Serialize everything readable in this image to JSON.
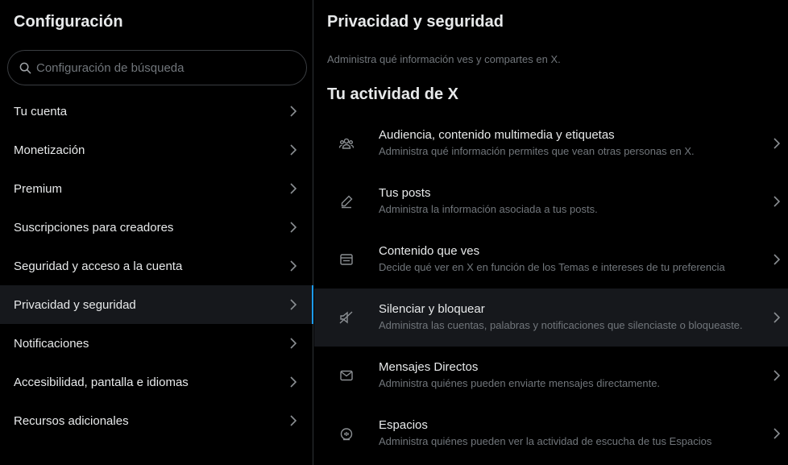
{
  "left": {
    "title": "Configuración",
    "search_placeholder": "Configuración de búsqueda",
    "items": [
      {
        "label": "Tu cuenta"
      },
      {
        "label": "Monetización"
      },
      {
        "label": "Premium"
      },
      {
        "label": "Suscripciones para creadores"
      },
      {
        "label": "Seguridad y acceso a la cuenta"
      },
      {
        "label": "Privacidad y seguridad",
        "active": true
      },
      {
        "label": "Notificaciones"
      },
      {
        "label": "Accesibilidad, pantalla e idiomas"
      },
      {
        "label": "Recursos adicionales"
      }
    ]
  },
  "right": {
    "title": "Privacidad y seguridad",
    "description": "Administra qué información ves y compartes en X.",
    "section_title": "Tu actividad de X",
    "options": [
      {
        "title": "Audiencia, contenido multimedia y etiquetas",
        "subtitle": "Administra qué información permites que vean otras personas en X.",
        "icon": "people-icon"
      },
      {
        "title": "Tus posts",
        "subtitle": "Administra la información asociada a tus posts.",
        "icon": "pencil-icon"
      },
      {
        "title": "Contenido que ves",
        "subtitle": "Decide qué ver en X en función de los Temas e intereses de tu preferencia",
        "icon": "content-card-icon"
      },
      {
        "title": "Silenciar y bloquear",
        "subtitle": "Administra las cuentas, palabras y notificaciones que silenciaste o bloqueaste.",
        "icon": "mute-icon"
      },
      {
        "title": "Mensajes Directos",
        "subtitle": "Administra quiénes pueden enviarte mensajes directamente.",
        "icon": "envelope-icon"
      },
      {
        "title": "Espacios",
        "subtitle": "Administra quiénes pueden ver la actividad de escucha de tus Espacios",
        "icon": "spaces-icon"
      }
    ]
  },
  "colors": {
    "background": "#000000",
    "text": "#e7e9ea",
    "muted": "#71767b",
    "active_bg": "#16181c",
    "accent": "#1d9bf0"
  }
}
